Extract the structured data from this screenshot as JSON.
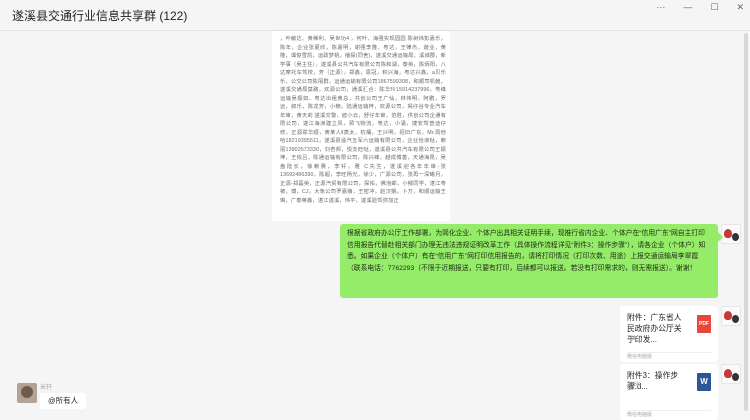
{
  "window": {
    "title": "遂溪县交通行业信息共享群 (122)",
    "controls": [
      "···",
      "—",
      "☐",
      "✕"
    ]
  },
  "messages": {
    "image_text": "，叶敏达、黄稀利、吴世功4 ，何叶、海强实现园园 陈树炜彭嘉乐，陈年，企业张夏欣，陈嘉明，谢强李隆、粤达，王律杰，谐业，黄隆，谭俊雪凯，运政梦桃，播探(同舍)，遂溪交通运输局，溪城郡，新学事（吴主任），遂溪县公共汽车有限公司陈和湖，泰英，陈炳阳，八达摩托车驾校，芳（正源），郑鑫，恩冠，积兴海，粤达兴鑫，a贝乐乐，公交公司陈丽群，运通运输有限公司1867599308，和顺司机鲍，遂溪交通局莫路，欢源公司，通溪汇合：陈华玲15914237996，粤峰运输吴振如，粤达出租黄总，共创公司王广仙，林伟明，阿鹏，罗远，叙乐，陈龙芳，小楠，陆通运输梓，欢源公司，揭仔谷专业汽车年审，黄天莉 遂溪交警，欧小云，舒仔年审，范胜，供创公司企通有限公司，遂江海洲建立风，颈飞物流，粤达，小涌，捷安驾普迪仔修，正源郑华顺，黄某人‖蒸太，杭桶，王兴明，招旧广东，Mr.周他哈18219395511，遂溪县遥汽五军六运输有限公司，企业恰浪哒，赖丽13902573330，刘杏邦，悦支旺哒，遂溪县公共汽车有限公司王振坤，王侬吕，陈通运输有限公司，陈兴峰，越成博善，天通海昆，吴盘陆长，徐赖赛，李钎，雅 C先生，遂溪迎各年年审-张13692486390，陈超，李旺杨光，徐少，广源公司，张再一深曦月，正源-郑磊英，正源汽贸有限公司，探佑，佛泡邮，小郁同学，湛江粤被，傅，CJ，大象公司罗嘉萌，王密冲，赵汉娥，卜万，和顺运输王琳，广泰蒋鑫，湛江遂溪，伟平，遂溪验驾弥加正",
    "green_bubble": "根据省政府办公厅工作部署，为简化企业、个体户出具相关证明手续，现推行省内企业、个体户在“信用广东”网自主打印信用报告代替赴相关部门办理无违法违规证明改革工作（具体操作流程详见“附件3：操作步骤”），请各企业（个体户）知悉。如果企业（个体户）有在“信用广东”网打印信用报告的，请将打印情况（打印次数、用途）上报交通运输局李翠霞（联系电话：7762293（不限于近期报送，只要有打印，后续都可以报送。若没有打印需求的，则无需报送）。谢谢！",
    "file1": {
      "name": "附件：广东省人民政府办公厅关于印发...",
      "size": "7M",
      "source": "微信电脑版"
    },
    "file2": {
      "name": "附件3：操作步骤.d...",
      "size": "716K",
      "source": "微信电脑版"
    },
    "pdf_label": "PDF",
    "word_label": "W",
    "last_sender": "米轩",
    "last_message": "@所有人"
  },
  "colors": {
    "green_bubble": "#95ec69",
    "pdf": "#e9473a",
    "word": "#2b5797",
    "chat_bg": "#f5f5f5"
  }
}
